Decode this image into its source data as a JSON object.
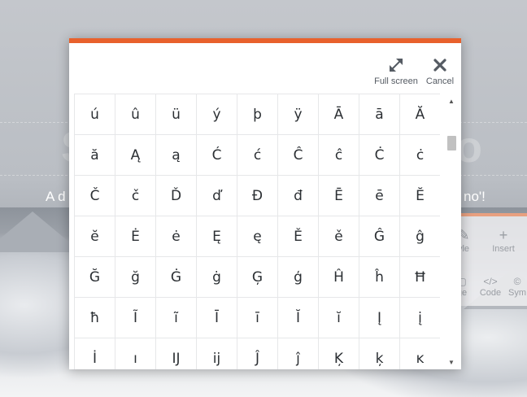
{
  "background": {
    "hero_text_left": "A d",
    "hero_text_right": "no'!",
    "toolbar": {
      "style_label": "yle",
      "insert_label": "Insert",
      "image_label": "ge",
      "code_label": "Code",
      "symbol_label": "Sym"
    }
  },
  "dialog": {
    "full_screen_label": "Full screen",
    "cancel_label": "Cancel",
    "accent_color": "#e8612c",
    "characters": [
      "ú",
      "û",
      "ü",
      "ý",
      "þ",
      "ÿ",
      "Ā",
      "ā",
      "Ă",
      "ă",
      "Ą",
      "ą",
      "Ć",
      "ć",
      "Ĉ",
      "ĉ",
      "Ċ",
      "ċ",
      "Č",
      "č",
      "Ď",
      "ď",
      "Đ",
      "đ",
      "Ē",
      "ē",
      "Ĕ",
      "ĕ",
      "Ė",
      "ė",
      "Ę",
      "ę",
      "Ě",
      "ě",
      "Ĝ",
      "ĝ",
      "Ğ",
      "ğ",
      "Ġ",
      "ġ",
      "Ģ",
      "ģ",
      "Ĥ",
      "ĥ",
      "Ħ",
      "ħ",
      "Ĩ",
      "ĩ",
      "Ī",
      "ī",
      "Ĭ",
      "ĭ",
      "Į",
      "į",
      "İ",
      "ı",
      "Ĳ",
      "ĳ",
      "Ĵ",
      "ĵ",
      "Ķ",
      "ķ",
      "ĸ"
    ]
  }
}
